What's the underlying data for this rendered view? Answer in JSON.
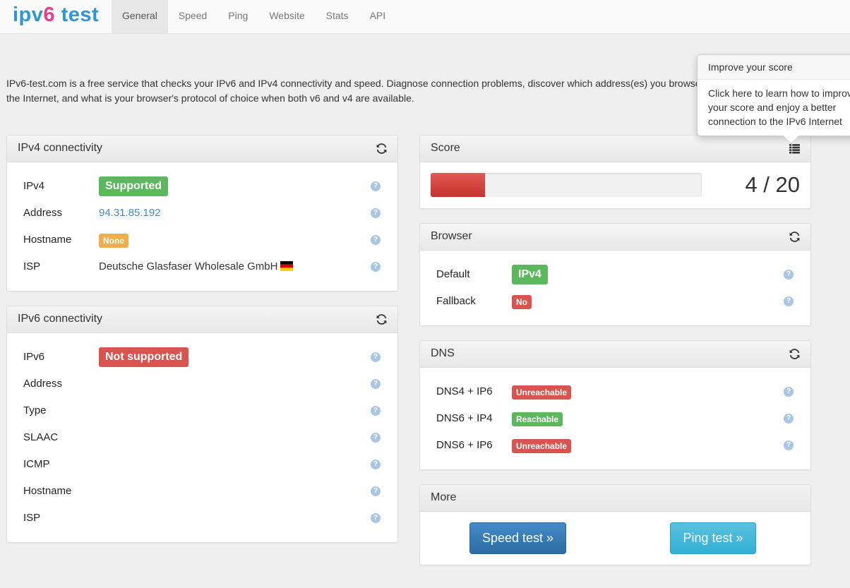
{
  "logo": {
    "part1": "ipv",
    "part2": "6",
    "part3": " test"
  },
  "nav": [
    "General",
    "Speed",
    "Ping",
    "Website",
    "Stats",
    "API"
  ],
  "intro": "IPv6-test.com is a free service that checks your IPv6 and IPv4 connectivity and speed. Diagnose connection problems, discover which address(es) you browse the Internet, and what is your browser's protocol of choice when both v6 and v4 are available.",
  "ipv4": {
    "title": "IPv4 connectivity",
    "rows": [
      {
        "label": "IPv4",
        "value": "Supported"
      },
      {
        "label": "Address",
        "value": "94.31.85.192"
      },
      {
        "label": "Hostname",
        "value": "None"
      },
      {
        "label": "ISP",
        "value": "Deutsche Glasfaser Wholesale GmbH"
      }
    ]
  },
  "ipv6": {
    "title": "IPv6 connectivity",
    "rows": [
      {
        "label": "IPv6",
        "value": "Not supported"
      },
      {
        "label": "Address"
      },
      {
        "label": "Type"
      },
      {
        "label": "SLAAC"
      },
      {
        "label": "ICMP"
      },
      {
        "label": "Hostname"
      },
      {
        "label": "ISP"
      }
    ]
  },
  "score": {
    "title": "Score",
    "value": 4,
    "max": 20,
    "text": "4 / 20"
  },
  "browser": {
    "title": "Browser",
    "rows": [
      {
        "label": "Default",
        "value": "IPv4"
      },
      {
        "label": "Fallback",
        "value": "No"
      }
    ]
  },
  "dns": {
    "title": "DNS",
    "rows": [
      {
        "label": "DNS4 + IP6",
        "value": "Unreachable"
      },
      {
        "label": "DNS6 + IP4",
        "value": "Reachable"
      },
      {
        "label": "DNS6 + IP6",
        "value": "Unreachable"
      }
    ]
  },
  "more": {
    "title": "More",
    "speed_button": "Speed test »",
    "ping_button": "Ping test »"
  },
  "popover": {
    "title": "Improve your score",
    "line1": "Click here to learn how to improve",
    "line2": "your score and enjoy a better",
    "line3": "connection to the IPv6 Internet"
  },
  "colors": {
    "success": "#5cb85c",
    "danger": "#d9534f",
    "warning": "#f0ad4e",
    "link": "#428bca",
    "primary": "#2d6ca2",
    "info": "#31b0d5"
  }
}
